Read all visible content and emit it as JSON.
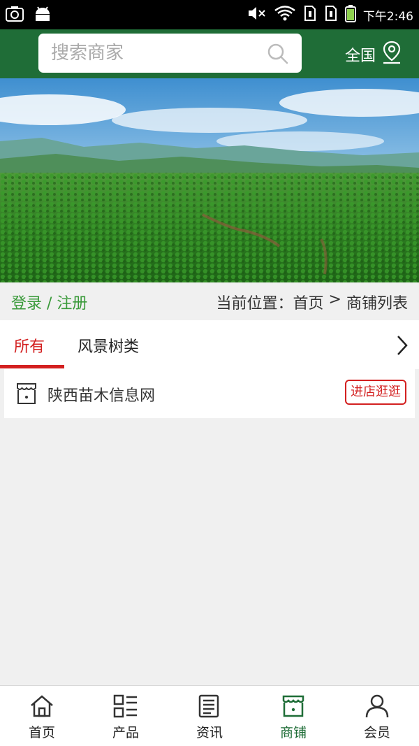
{
  "status_bar": {
    "time": "下午2:46",
    "icons": [
      "camera-icon",
      "android-icon",
      "mute-icon",
      "wifi-icon",
      "sim1-icon",
      "sim2-icon",
      "battery-icon"
    ]
  },
  "header": {
    "search_placeholder": "搜索商家",
    "region_label": "全国",
    "background_color": "#1f6d37"
  },
  "breadcrumb": {
    "login_label": "登录 / 注册",
    "location_prefix": "当前位置：",
    "home": "首页",
    "separator": " > ",
    "current": "商铺列表"
  },
  "tabs": [
    {
      "label": "所有",
      "active": true
    },
    {
      "label": "风景树类",
      "active": false
    }
  ],
  "shops": [
    {
      "name": "陕西苗木信息网",
      "action_label": "进店逛逛"
    }
  ],
  "bottom_nav": [
    {
      "label": "首页",
      "icon": "home-icon",
      "active": false
    },
    {
      "label": "产品",
      "icon": "product-grid-icon",
      "active": false
    },
    {
      "label": "资讯",
      "icon": "news-icon",
      "active": false
    },
    {
      "label": "商铺",
      "icon": "shop-icon",
      "active": true
    },
    {
      "label": "会员",
      "icon": "member-icon",
      "active": false
    }
  ],
  "colors": {
    "brand_green": "#1f6d37",
    "accent_red": "#d32020",
    "login_green": "#3a9a3a"
  }
}
